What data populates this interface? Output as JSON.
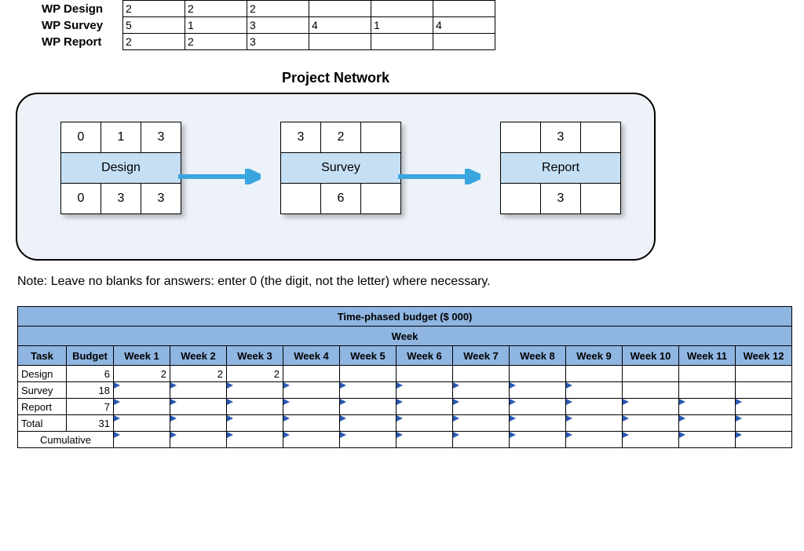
{
  "wp_table": {
    "rows": [
      {
        "label": "WP Design",
        "vals": [
          "2",
          "2",
          "2",
          "",
          "",
          ""
        ]
      },
      {
        "label": "WP Survey",
        "vals": [
          "5",
          "1",
          "3",
          "4",
          "1",
          "4"
        ]
      },
      {
        "label": "WP Report",
        "vals": [
          "2",
          "2",
          "3",
          "",
          "",
          ""
        ]
      }
    ]
  },
  "network": {
    "title": "Project Network",
    "nodes": [
      {
        "name": "Design",
        "top": [
          "0",
          "1",
          "3"
        ],
        "bot": [
          "0",
          "3",
          "3"
        ]
      },
      {
        "name": "Survey",
        "top": [
          "3",
          "2",
          ""
        ],
        "bot": [
          "",
          "6",
          ""
        ]
      },
      {
        "name": "Report",
        "top": [
          "",
          "3",
          ""
        ],
        "bot": [
          "",
          "3",
          ""
        ]
      }
    ]
  },
  "note": "Note: Leave no blanks for answers: enter 0 (the digit, not the letter) where necessary.",
  "budget": {
    "title": "Time-phased budget ($ 000)",
    "subtitle": "Week",
    "headers": [
      "Task",
      "Budget",
      "Week 1",
      "Week 2",
      "Week 3",
      "Week 4",
      "Week 5",
      "Week 6",
      "Week 7",
      "Week 8",
      "Week 9",
      "Week 10",
      "Week 11",
      "Week 12"
    ],
    "rows": [
      {
        "task": "Design",
        "budget": "6",
        "cells": [
          {
            "v": "2",
            "in": false
          },
          {
            "v": "2",
            "in": false
          },
          {
            "v": "2",
            "in": false
          },
          {
            "v": "",
            "in": false
          },
          {
            "v": "",
            "in": false
          },
          {
            "v": "",
            "in": false
          },
          {
            "v": "",
            "in": false
          },
          {
            "v": "",
            "in": false
          },
          {
            "v": "",
            "in": false
          },
          {
            "v": "",
            "in": false
          },
          {
            "v": "",
            "in": false
          },
          {
            "v": "",
            "in": false
          }
        ]
      },
      {
        "task": "Survey",
        "budget": "18",
        "cells": [
          {
            "v": "",
            "in": true
          },
          {
            "v": "",
            "in": true
          },
          {
            "v": "",
            "in": true
          },
          {
            "v": "",
            "in": true
          },
          {
            "v": "",
            "in": true
          },
          {
            "v": "",
            "in": true
          },
          {
            "v": "",
            "in": true
          },
          {
            "v": "",
            "in": true
          },
          {
            "v": "",
            "in": true
          },
          {
            "v": "",
            "in": false
          },
          {
            "v": "",
            "in": false
          },
          {
            "v": "",
            "in": false
          }
        ]
      },
      {
        "task": "Report",
        "budget": "7",
        "cells": [
          {
            "v": "",
            "in": true
          },
          {
            "v": "",
            "in": true
          },
          {
            "v": "",
            "in": true
          },
          {
            "v": "",
            "in": true
          },
          {
            "v": "",
            "in": true
          },
          {
            "v": "",
            "in": true
          },
          {
            "v": "",
            "in": true
          },
          {
            "v": "",
            "in": true
          },
          {
            "v": "",
            "in": true
          },
          {
            "v": "",
            "in": true
          },
          {
            "v": "",
            "in": true
          },
          {
            "v": "",
            "in": true
          }
        ]
      },
      {
        "task": "Total",
        "budget": "31",
        "cells": [
          {
            "v": "",
            "in": true
          },
          {
            "v": "",
            "in": true
          },
          {
            "v": "",
            "in": true
          },
          {
            "v": "",
            "in": true
          },
          {
            "v": "",
            "in": true
          },
          {
            "v": "",
            "in": true
          },
          {
            "v": "",
            "in": true
          },
          {
            "v": "",
            "in": true
          },
          {
            "v": "",
            "in": true
          },
          {
            "v": "",
            "in": true
          },
          {
            "v": "",
            "in": true
          },
          {
            "v": "",
            "in": true
          }
        ]
      }
    ],
    "cumulative": {
      "task": "Cumulative",
      "cells": [
        {
          "v": "",
          "in": true
        },
        {
          "v": "",
          "in": true
        },
        {
          "v": "",
          "in": true
        },
        {
          "v": "",
          "in": true
        },
        {
          "v": "",
          "in": true
        },
        {
          "v": "",
          "in": true
        },
        {
          "v": "",
          "in": true
        },
        {
          "v": "",
          "in": true
        },
        {
          "v": "",
          "in": true
        },
        {
          "v": "",
          "in": true
        },
        {
          "v": "",
          "in": true
        },
        {
          "v": "",
          "in": true
        }
      ]
    }
  }
}
